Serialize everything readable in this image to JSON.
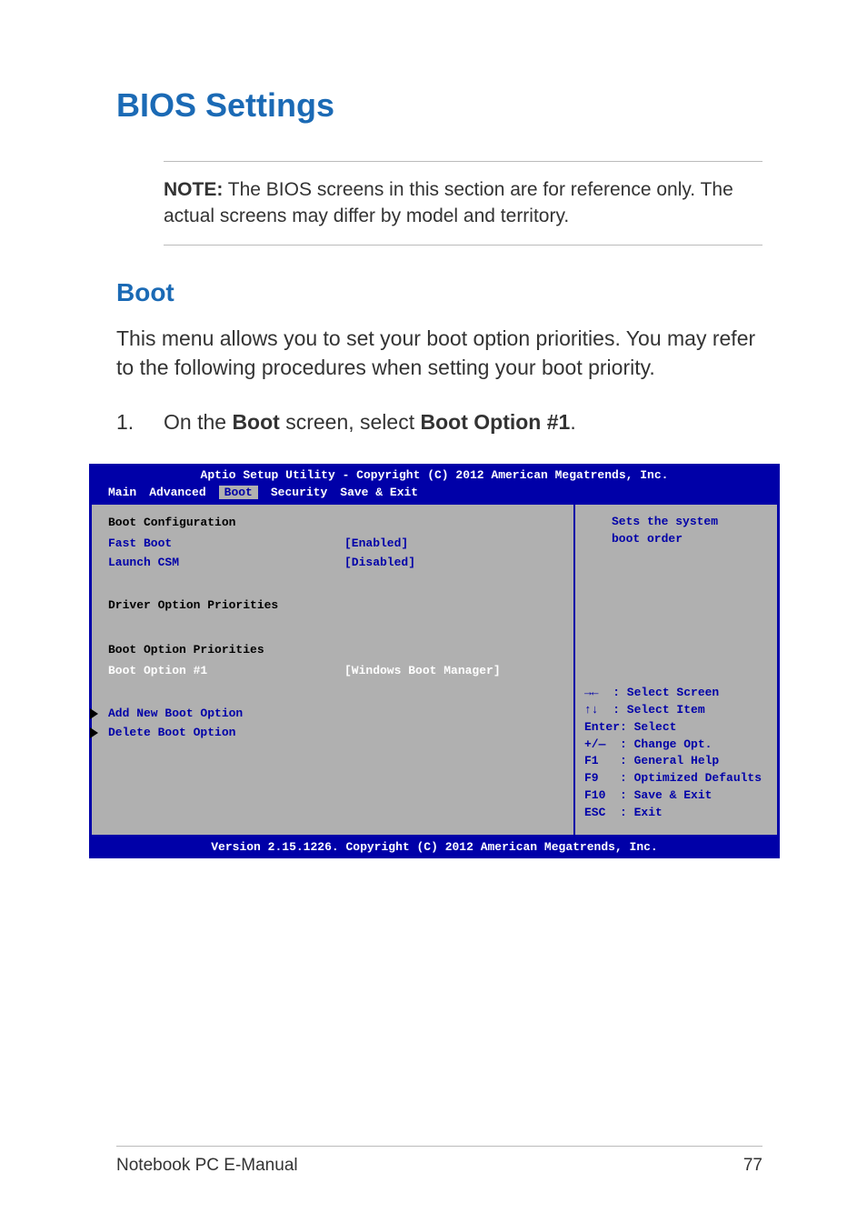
{
  "page": {
    "title": "BIOS Settings",
    "note_label": "NOTE:",
    "note_text": " The BIOS screens in this section are for reference only. The actual screens may differ by model and territory.",
    "section_heading": "Boot",
    "section_body": "This menu allows you to set your boot option priorities. You may refer to the following procedures when setting your boot priority.",
    "step_num": "1.",
    "step_prefix": "On the ",
    "step_bold1": "Boot",
    "step_mid": " screen, select ",
    "step_bold2": "Boot Option #1",
    "step_suffix": "."
  },
  "bios": {
    "title": "Aptio Setup Utility - Copyright (C) 2012 American Megatrends, Inc.",
    "tabs": [
      "Main",
      "Advanced",
      "Boot",
      "Security",
      "Save & Exit"
    ],
    "active_tab": "Boot",
    "left": {
      "config_heading": "Boot Configuration",
      "fast_boot_label": "Fast Boot",
      "fast_boot_value": "[Enabled]",
      "launch_csm_label": "Launch CSM",
      "launch_csm_value": "[Disabled]",
      "driver_heading": "Driver Option Priorities",
      "boot_priorities_heading": "Boot Option Priorities",
      "boot_opt1_label": "Boot Option #1",
      "boot_opt1_value": "[Windows Boot Manager]",
      "add_new": "Add New Boot Option",
      "delete": "Delete Boot Option"
    },
    "right": {
      "desc1": "Sets the system",
      "desc2": "boot order",
      "help": [
        "→←  : Select Screen",
        "↑↓  : Select Item",
        "Enter: Select",
        "+/—  : Change Opt.",
        "F1   : General Help",
        "F9   : Optimized Defaults",
        "F10  : Save & Exit",
        "ESC  : Exit"
      ]
    },
    "footer": "Version 2.15.1226. Copyright (C) 2012 American Megatrends, Inc."
  },
  "footer": {
    "left": "Notebook PC E-Manual",
    "right": "77"
  }
}
